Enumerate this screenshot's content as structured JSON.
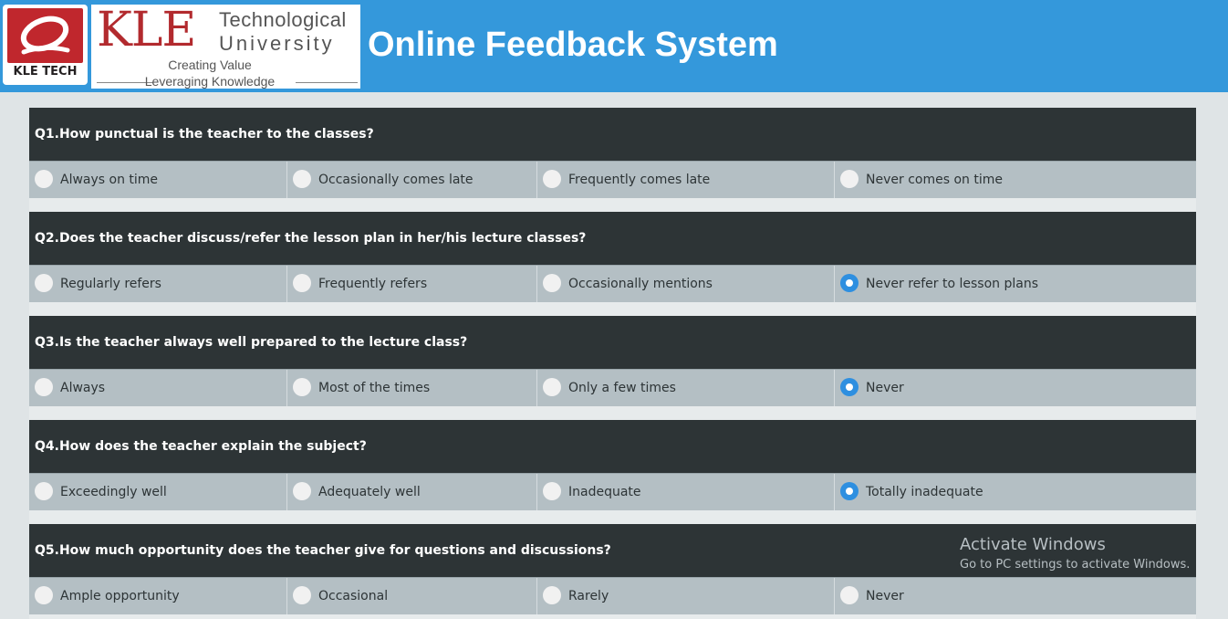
{
  "header": {
    "logo_caption": "KLE TECH",
    "brand_kle": "KLE",
    "brand_line1": "Technological",
    "brand_line2": "University",
    "tagline1": "Creating Value",
    "tagline2": "Leveraging Knowledge",
    "title": "Online Feedback System",
    "bg_color": "#3498db"
  },
  "questions": [
    {
      "text": "Q1.How punctual is the teacher to the classes?",
      "options": [
        "Always on time",
        "Occasionally comes late",
        "Frequently comes late",
        "Never comes on time"
      ],
      "selected": null
    },
    {
      "text": "Q2.Does the teacher discuss/refer the lesson plan in her/his lecture classes?",
      "options": [
        "Regularly refers",
        "Frequently refers",
        "Occasionally mentions",
        "Never refer to lesson plans"
      ],
      "selected": 3
    },
    {
      "text": "Q3.Is the teacher always well prepared to the lecture class?",
      "options": [
        "Always",
        "Most of the times",
        "Only a few times",
        "Never"
      ],
      "selected": 3
    },
    {
      "text": "Q4.How does the teacher explain the subject?",
      "options": [
        "Exceedingly well",
        "Adequately well",
        "Inadequate",
        "Totally inadequate"
      ],
      "selected": 3
    },
    {
      "text": "Q5.How much opportunity does the teacher give for questions and discussions?",
      "options": [
        "Ample opportunity",
        "Occasional",
        "Rarely",
        "Never"
      ],
      "selected": null
    }
  ],
  "watermark": {
    "line1": "Activate Windows",
    "line2": "Go to PC settings to activate Windows."
  }
}
